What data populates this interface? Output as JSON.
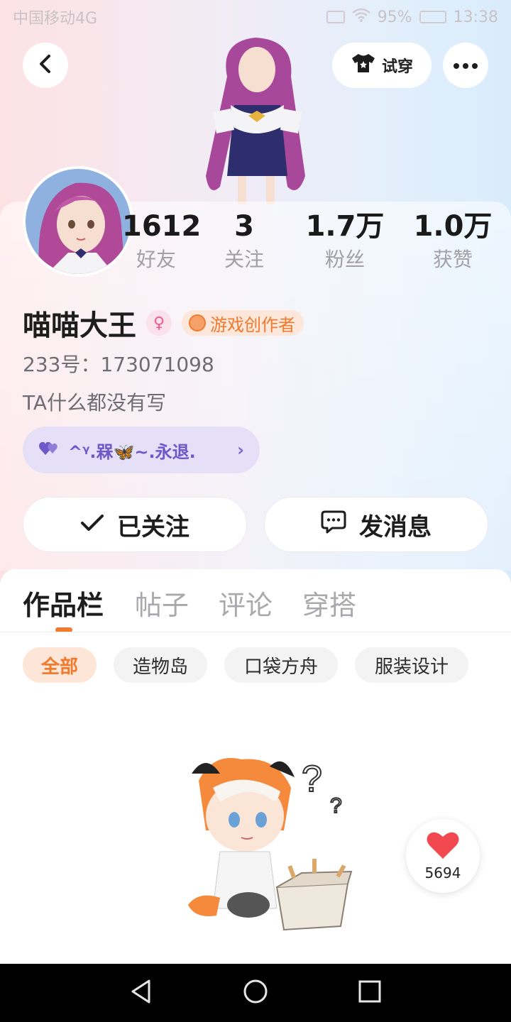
{
  "status_bar": {
    "carrier": "中国移动4G",
    "battery": "95%",
    "time": "13:38"
  },
  "header": {
    "back_icon": "chevron-left-icon",
    "try_on_label": "试穿",
    "try_on_icon": "shirt-icon",
    "more_icon": "more-horizontal-icon"
  },
  "stats": [
    {
      "value": "1612",
      "label": "好友"
    },
    {
      "value": "3",
      "label": "关注"
    },
    {
      "value": "1.7万",
      "label": "粉丝"
    },
    {
      "value": "1.0万",
      "label": "获赞"
    }
  ],
  "profile": {
    "name": "喵喵大王",
    "gender_icon": "female-icon",
    "creator_badge": "游戏创作者",
    "uid": "233号：173071098",
    "bio": "TA什么都没有写",
    "cp_label": "^ᵞ.槑🦋~.永退."
  },
  "actions": {
    "follow_label": "已关注",
    "message_label": "发消息"
  },
  "tabs": [
    {
      "label": "作品栏",
      "active": true
    },
    {
      "label": "帖子",
      "active": false
    },
    {
      "label": "评论",
      "active": false
    },
    {
      "label": "穿搭",
      "active": false
    }
  ],
  "filters": [
    {
      "label": "全部",
      "active": true
    },
    {
      "label": "造物岛",
      "active": false
    },
    {
      "label": "口袋方舟",
      "active": false
    },
    {
      "label": "服装设计",
      "active": false
    }
  ],
  "like_fab": {
    "icon": "heart-icon",
    "count": "5694"
  },
  "colors": {
    "accent": "#f07a2e",
    "cp_purple": "#6c58c9"
  }
}
